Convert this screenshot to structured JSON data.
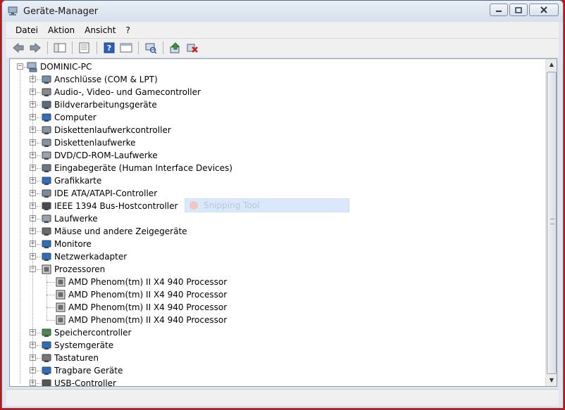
{
  "window": {
    "title": "Geräte-Manager"
  },
  "titlebar_buttons": {
    "minimize": "▭",
    "maximize": "▢",
    "close": "X"
  },
  "menu": [
    "Datei",
    "Aktion",
    "Ansicht",
    "?"
  ],
  "toolbar": [
    "back-icon",
    "forward-icon",
    "tree-view-icon",
    "properties-icon",
    "help-icon",
    "details-icon",
    "scan-hardware-icon",
    "update-driver-icon",
    "uninstall-icon"
  ],
  "tree": {
    "root": "DOMINIC-PC",
    "categories": [
      {
        "label": "Anschlüsse (COM & LPT)",
        "icon": "port-icon",
        "expanded": false
      },
      {
        "label": "Audio-, Video- und Gamecontroller",
        "icon": "speaker-icon",
        "expanded": false
      },
      {
        "label": "Bildverarbeitungsgeräte",
        "icon": "camera-icon",
        "expanded": false
      },
      {
        "label": "Computer",
        "icon": "computer-icon",
        "expanded": false
      },
      {
        "label": "Diskettenlaufwerkcontroller",
        "icon": "floppy-controller-icon",
        "expanded": false
      },
      {
        "label": "Diskettenlaufwerke",
        "icon": "floppy-drive-icon",
        "expanded": false
      },
      {
        "label": "DVD/CD-ROM-Laufwerke",
        "icon": "dvd-drive-icon",
        "expanded": false
      },
      {
        "label": "Eingabegeräte (Human Interface Devices)",
        "icon": "hid-icon",
        "expanded": false
      },
      {
        "label": "Grafikkarte",
        "icon": "display-adapter-icon",
        "expanded": false
      },
      {
        "label": "IDE ATA/ATAPI-Controller",
        "icon": "ide-controller-icon",
        "expanded": false
      },
      {
        "label": "IEEE 1394 Bus-Hostcontroller",
        "icon": "firewire-icon",
        "expanded": false
      },
      {
        "label": "Laufwerke",
        "icon": "disk-drive-icon",
        "expanded": false
      },
      {
        "label": "Mäuse und andere Zeigegeräte",
        "icon": "mouse-icon",
        "expanded": false
      },
      {
        "label": "Monitore",
        "icon": "monitor-icon",
        "expanded": false
      },
      {
        "label": "Netzwerkadapter",
        "icon": "network-adapter-icon",
        "expanded": false
      },
      {
        "label": "Prozessoren",
        "icon": "processor-icon",
        "expanded": true,
        "children": [
          "AMD Phenom(tm) II X4 940 Processor",
          "AMD Phenom(tm) II X4 940 Processor",
          "AMD Phenom(tm) II X4 940 Processor",
          "AMD Phenom(tm) II X4 940 Processor"
        ]
      },
      {
        "label": "Speichercontroller",
        "icon": "storage-controller-icon",
        "expanded": false
      },
      {
        "label": "Systemgeräte",
        "icon": "system-device-icon",
        "expanded": false
      },
      {
        "label": "Tastaturen",
        "icon": "keyboard-icon",
        "expanded": false
      },
      {
        "label": "Tragbare Geräte",
        "icon": "portable-device-icon",
        "expanded": false
      },
      {
        "label": "USB-Controller",
        "icon": "usb-icon",
        "expanded": false
      }
    ]
  },
  "overlay": {
    "text": "Snipping Tool"
  }
}
